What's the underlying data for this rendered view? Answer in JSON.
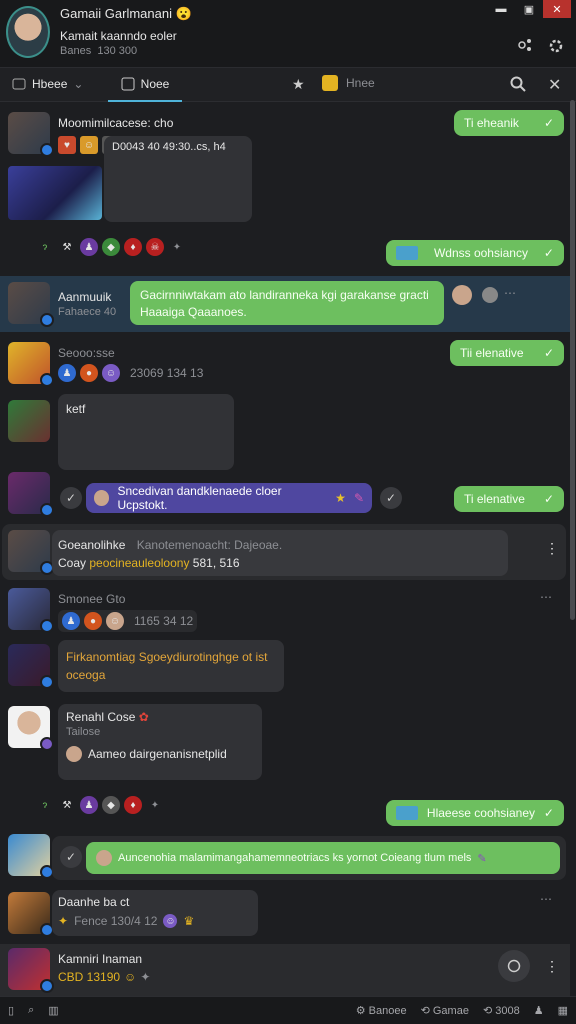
{
  "window": {
    "title": "Gamaii Garlmanani",
    "title_emoji": "😮",
    "btn_min": "▬",
    "btn_max": "▣",
    "btn_close": "✕"
  },
  "profile": {
    "name": "Kamait kaanndo eoler",
    "status": "Banes",
    "count": "130 300"
  },
  "tabs": {
    "home": "Hbeee",
    "active": "Noee",
    "extra": "Hnee"
  },
  "messages": [
    {
      "name": "Moomimilcacese: cho",
      "line1": "D0043 40 49:30..cs, h4",
      "right": "Ti eheanik"
    },
    {
      "right": "Wdnss oohsiancy"
    },
    {
      "name": "Aanmuuik",
      "sub": "Fahaece 40",
      "text1": "Gacirnniwtakam ato landiranneka kgi garakanse gracti",
      "text2": "Haaaiga Qaaanoes."
    },
    {
      "name": "Seooo:sse",
      "line1": "23069 134  13",
      "right": "Tii elenative"
    },
    {
      "text": "ketf"
    },
    {
      "text": "Sncedivan dandklenaede cloer Ucpstokt.",
      "right": "Ti elenative"
    },
    {
      "name": "Goeanolihke",
      "sub": "Kanotemenoacht: Dajeoae.",
      "line1": "Coay",
      "line1b": "peocineauleoloony",
      "line1c": "581, 516"
    },
    {
      "name": "Smonee  Gto",
      "line1": "1165 34  12"
    },
    {
      "text1": "Firkanomtiag Sgoeydiurotinghge ot ist",
      "text2": "oceoga"
    },
    {
      "name": "Renahl Cose",
      "sub": "Tailose",
      "line1": "Aameo dairgenanisnetplid"
    },
    {
      "right": "Hlaeese coohsianey"
    },
    {
      "text": "Auncenohia malamimangahamemneotriacs ks yornot Coieang tlum mels"
    },
    {
      "name": "Daanhe ba ct",
      "line1": "Fence  130/4  12"
    },
    {
      "name": "Kamniri Inaman",
      "line1": "CBD  13190"
    }
  ],
  "bottom": {
    "left1": "Banoee",
    "left2": "Gamae",
    "left3": "3008"
  }
}
